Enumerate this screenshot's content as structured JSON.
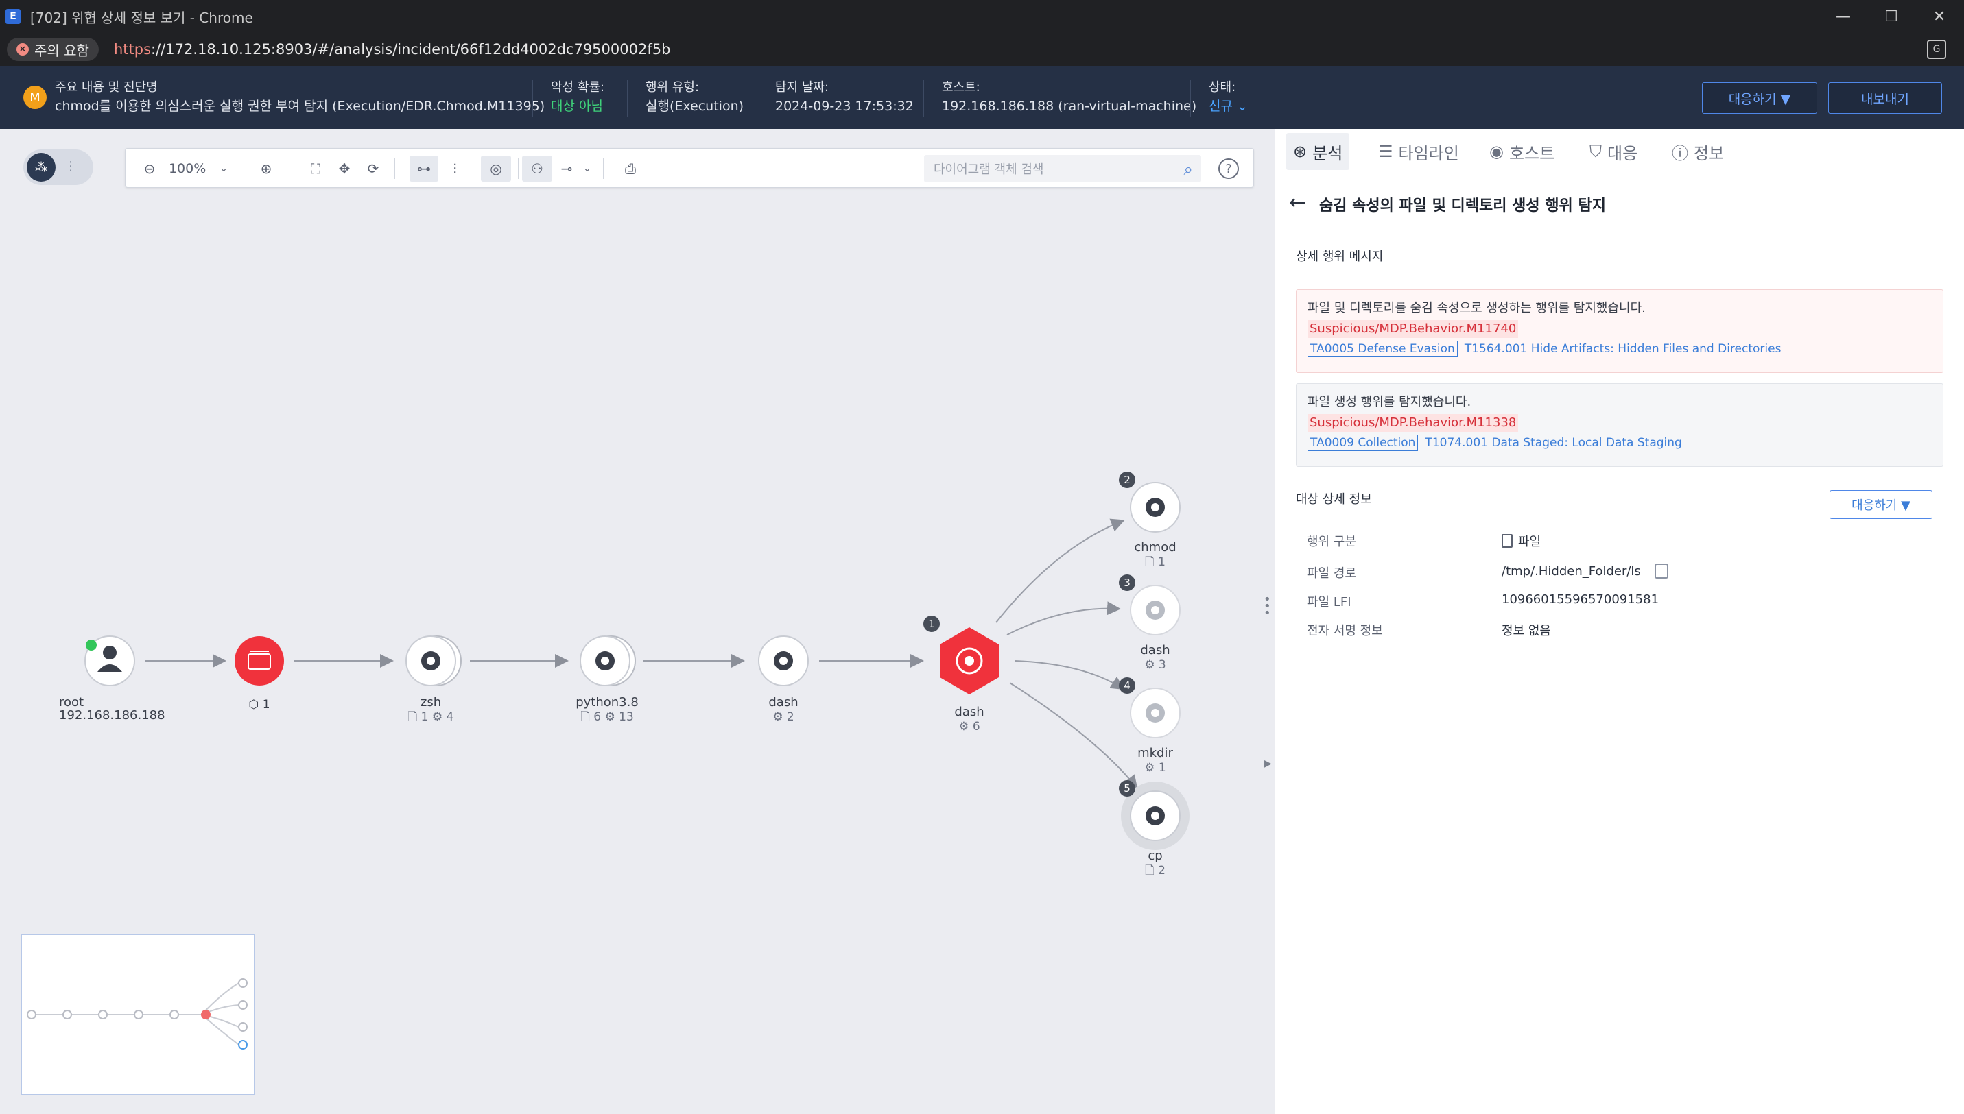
{
  "browser": {
    "window_title": "[702] 위협 상세 정보 보기 - Chrome",
    "app_icon": "E",
    "security_chip": "주의 요함",
    "url_scheme": "https",
    "url_rest": "://172.18.10.125:8903/#/analysis/incident/66f12dd4002dc79500002f5b",
    "controls": {
      "minimize": "—",
      "maximize": "☐",
      "close": "✕"
    }
  },
  "header": {
    "avatar": "M",
    "main_label": "주요 내용 및 진단명",
    "main_value": "chmod를 이용한 의심스러운 실행 권한 부여 탐지 (Execution/EDR.Chmod.M11395)",
    "malicious_label": "악성 확률:",
    "malicious_value": "대상 아님",
    "behavior_label": "행위 유형:",
    "behavior_value": "실행(Execution)",
    "date_label": "탐지 날짜:",
    "date_value": "2024-09-23 17:53:32",
    "host_label": "호스트:",
    "host_value": "192.168.186.188 (ran-virtual-machine)",
    "status_label": "상태:",
    "status_value": "신규",
    "respond_button": "대응하기 ▼",
    "export_button": "내보내기",
    "accent_color": "#4aa3ff",
    "safe_color": "#3fd27a"
  },
  "toolbar": {
    "zoom": "100%",
    "search_placeholder": "다이어그램 객체 검색",
    "help": "?"
  },
  "graph": {
    "nodes": [
      {
        "id": "root",
        "label": "root",
        "sub": "192.168.186.188"
      },
      {
        "id": "archive",
        "label": "",
        "sub": "⬡ 1"
      },
      {
        "id": "zsh",
        "label": "zsh",
        "sub": "🗋 1  ⚙ 4"
      },
      {
        "id": "python",
        "label": "python3.8",
        "sub": "🗋 6  ⚙ 13"
      },
      {
        "id": "dash1",
        "label": "dash",
        "sub": "⚙ 2"
      },
      {
        "id": "dash2",
        "label": "dash",
        "sub": "⚙ 6",
        "badge": "1"
      },
      {
        "id": "chmod",
        "label": "chmod",
        "sub": "🗋 1",
        "badge": "2"
      },
      {
        "id": "dash3",
        "label": "dash",
        "sub": "⚙ 3",
        "badge": "3"
      },
      {
        "id": "mkdir",
        "label": "mkdir",
        "sub": "⚙ 1",
        "badge": "4"
      },
      {
        "id": "cp",
        "label": "cp",
        "sub": "🗋 2",
        "badge": "5"
      }
    ],
    "alert_color": "#f0323c"
  },
  "panel": {
    "tabs": [
      {
        "icon": "⊛",
        "label": "분석"
      },
      {
        "icon": "☰",
        "label": "타임라인"
      },
      {
        "icon": "◉",
        "label": "호스트"
      },
      {
        "icon": "⛉",
        "label": "대응"
      },
      {
        "icon": "ⓘ",
        "label": "정보"
      }
    ],
    "title": "숨김 속성의 파일 및 디렉토리 생성 행위 탐지",
    "messages_title": "상세 행위 메시지",
    "messages": [
      {
        "text": "파일 및 디렉토리를 숨김 속성으로 생성하는 행위를 탐지했습니다.",
        "rule": "Suspicious/MDP.Behavior.M11740",
        "tactic": "TA0005 Defense Evasion",
        "technique": "T1564.001 Hide Artifacts: Hidden Files and Directories"
      },
      {
        "text": "파일 생성 행위를 탐지했습니다.",
        "rule": "Suspicious/MDP.Behavior.M11338",
        "tactic": "TA0009 Collection",
        "technique": "T1074.001 Data Staged: Local Data Staging"
      }
    ],
    "target_title": "대상 상세 정보",
    "respond_button": "대응하기   ▼",
    "details": [
      {
        "label": "행위 구분",
        "value": "파일"
      },
      {
        "label": "파일 경로",
        "value": "/tmp/.Hidden_Folder/ls"
      },
      {
        "label": "파일 LFI",
        "value": "10966015596570091581"
      },
      {
        "label": "전자 서명 정보",
        "value": "정보 없음"
      }
    ]
  }
}
